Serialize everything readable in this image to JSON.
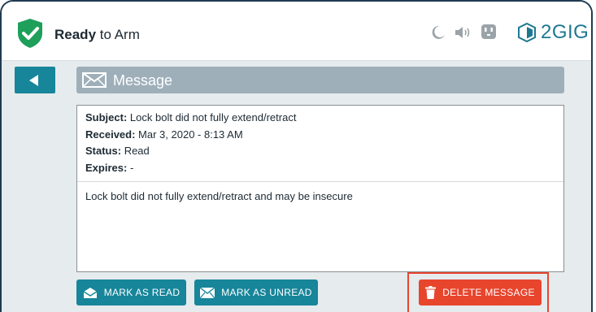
{
  "header": {
    "status_bold": "Ready",
    "status_rest": " to Arm",
    "brand": "2GIG",
    "icons": [
      "shield-check-icon",
      "moon-icon",
      "speaker-icon",
      "outlet-icon",
      "2gig-logo-icon"
    ]
  },
  "message": {
    "title": "Message",
    "subject_label": "Subject:",
    "subject": "Lock bolt did not fully extend/retract",
    "received_label": "Received:",
    "received": "Mar 3, 2020 - 8:13 AM",
    "status_label": "Status:",
    "status": "Read",
    "expires_label": "Expires:",
    "expires": "-",
    "body": "Lock bolt did not fully extend/retract and may be insecure"
  },
  "actions": {
    "mark_read": "MARK AS READ",
    "mark_unread": "MARK AS UNREAD",
    "delete": "DELETE MESSAGE"
  },
  "colors": {
    "teal": "#17859a",
    "shield_green": "#1e9f5a",
    "delete_red": "#e8452d",
    "message_bar": "#9eafba",
    "icon_grey": "#9aa3a8"
  }
}
